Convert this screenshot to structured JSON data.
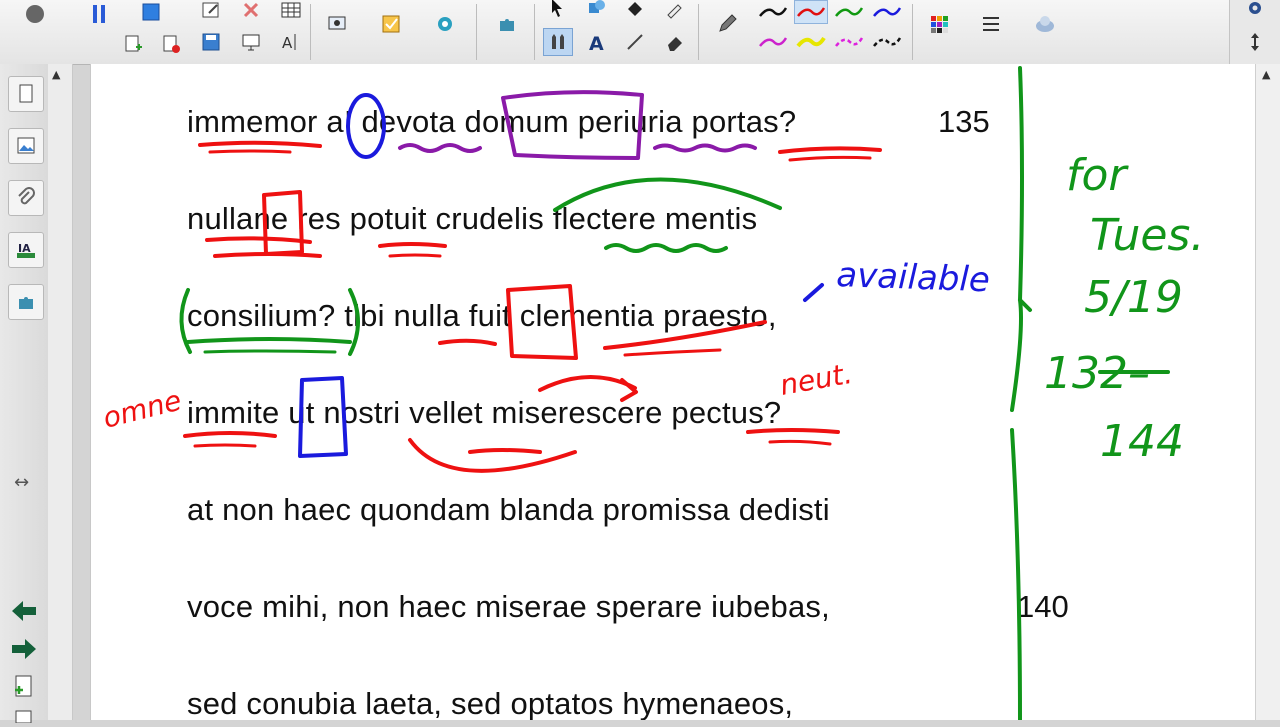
{
  "toolbar": {
    "tools": [
      "arrow-icon",
      "pen-icon",
      "text-icon",
      "line-icon",
      "eraser-icon"
    ],
    "pen_colors": [
      "#111111",
      "#e01010",
      "#119911",
      "#1a1add",
      "#cc22cc",
      "#dddd00",
      "#dd22dd",
      "#111111"
    ],
    "palette_colors": [
      "#e02020",
      "#f0a000",
      "#20a020",
      "#2050e0",
      "#a020c0",
      "#20c0c0"
    ]
  },
  "text": {
    "lines": [
      "immemor a! devota domum periuria portas?",
      "nullane res potuit crudelis flectere mentis",
      "consilium? tibi nulla fuit clementia praesto,",
      "immite ut nostri vellet miserescere pectus?",
      "at non haec quondam blanda promissa dedisti",
      "voce mihi, non haec miserae sperare iubebas,",
      "sed conubia laeta, sed optatos hymenaeos,"
    ],
    "line_numbers": [
      "135",
      "140"
    ]
  },
  "annotations": {
    "omne": "omne",
    "neut": "neut.",
    "available": "available",
    "for": "for",
    "tues": "Tues.",
    "date": "5/19",
    "range_start": "132–",
    "range_end": "144"
  },
  "colors": {
    "red_ink": "#ee1111",
    "blue_ink": "#1a1add",
    "green_ink": "#11951a",
    "purple_ink": "#8a1aa8"
  }
}
